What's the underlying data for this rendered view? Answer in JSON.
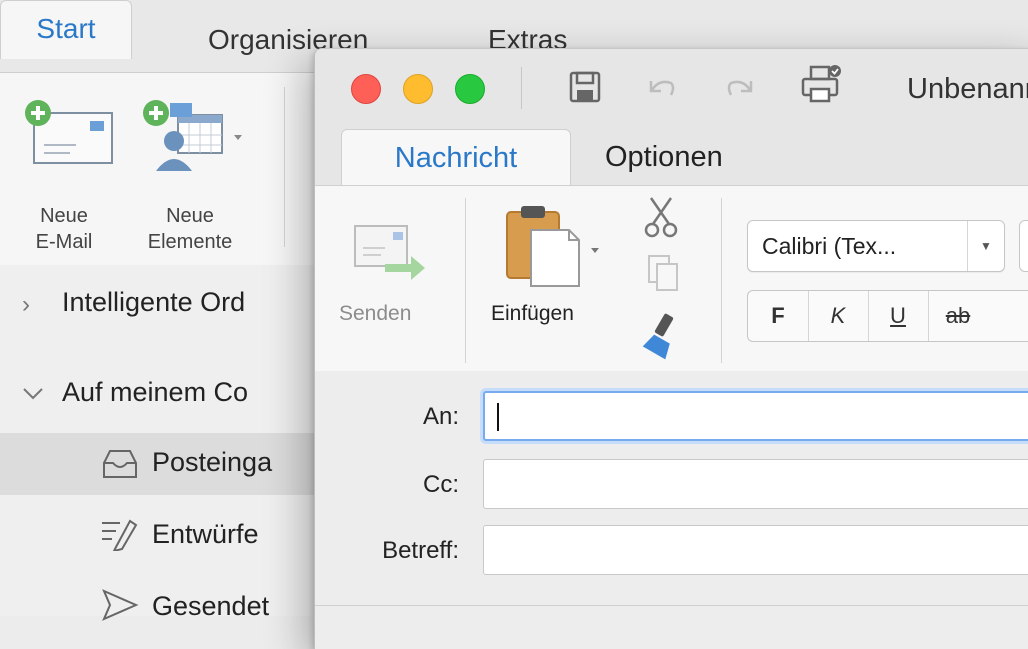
{
  "main": {
    "tabs": {
      "start": "Start",
      "organisieren": "Organisieren",
      "extras": "Extras"
    },
    "ribbon": {
      "new_email": [
        "Neue",
        "E-Mail"
      ],
      "new_items": [
        "Neue",
        "Elemente"
      ]
    },
    "sidebar": {
      "smart_folders": "Intelligente Ord",
      "on_my_computer": "Auf meinem Co",
      "inbox": "Posteinga",
      "drafts": "Entwürfe",
      "sent": "Gesendet"
    }
  },
  "compose": {
    "title": "Unbenannt",
    "tabs": {
      "nachricht": "Nachricht",
      "optionen": "Optionen"
    },
    "ribbon": {
      "send_label": "Senden",
      "paste_label": "Einfügen",
      "font_name": "Calibri (Tex...",
      "bold": "F",
      "italic": "K",
      "underline": "U",
      "strike": "ab"
    },
    "fields": {
      "to_label": "An:",
      "cc_label": "Cc:",
      "subject_label": "Betreff:",
      "to_value": "",
      "cc_value": "",
      "subject_value": ""
    }
  },
  "colors": {
    "accent": "#2a78c8",
    "close": "#fe5f57",
    "minimize": "#febc2e",
    "maximize": "#28c840",
    "focus_ring": "#78aaf0"
  }
}
